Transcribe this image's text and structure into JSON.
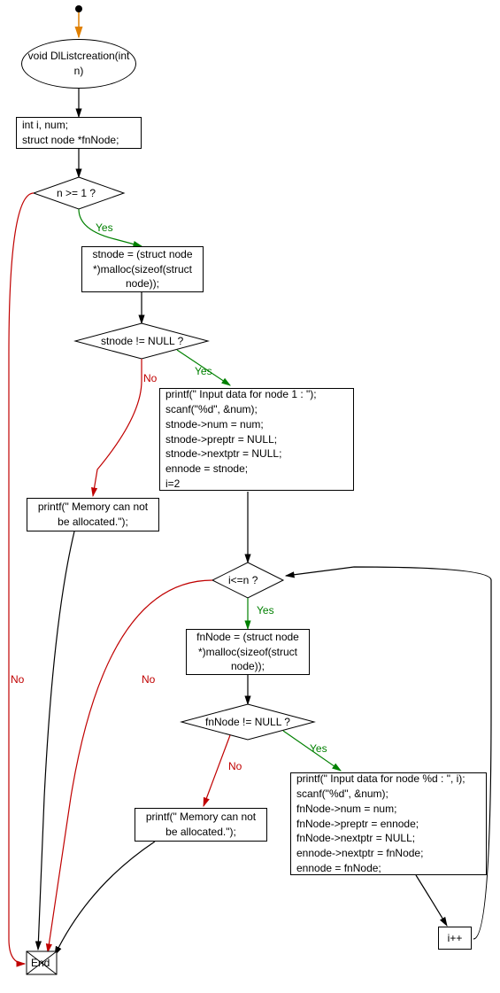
{
  "chart_data": {
    "type": "flowchart",
    "title": "void DlListcreation(int n)",
    "nodes": [
      {
        "id": "start",
        "type": "start",
        "label": ""
      },
      {
        "id": "func",
        "type": "terminator",
        "label": "void DlListcreation(int n)"
      },
      {
        "id": "decl",
        "type": "process",
        "label": "int i, num;\nstruct node *fnNode;"
      },
      {
        "id": "d1",
        "type": "decision",
        "label": "n >= 1 ?"
      },
      {
        "id": "p1",
        "type": "process",
        "label": "stnode = (struct node *)malloc(sizeof(struct node));"
      },
      {
        "id": "d2",
        "type": "decision",
        "label": "stnode != NULL ?"
      },
      {
        "id": "p2",
        "type": "process",
        "label": "printf(\" Input data for node 1 : \");\nscanf(\"%d\", &num);\nstnode->num = num;\nstnode->preptr = NULL;\nstnode->nextptr = NULL;\nennode = stnode;\ni=2"
      },
      {
        "id": "e1",
        "type": "process",
        "label": "printf(\" Memory can not be allocated.\");"
      },
      {
        "id": "d3",
        "type": "decision",
        "label": "i<=n ?"
      },
      {
        "id": "p3",
        "type": "process",
        "label": "fnNode = (struct node *)malloc(sizeof(struct node));"
      },
      {
        "id": "d4",
        "type": "decision",
        "label": "fnNode != NULL ?"
      },
      {
        "id": "p4",
        "type": "process",
        "label": "printf(\" Input data for node %d : \", i);\nscanf(\"%d\", &num);\nfnNode->num = num;\nfnNode->preptr = ennode;\nfnNode->nextptr = NULL;\nennode->nextptr = fnNode;\nennode = fnNode;"
      },
      {
        "id": "e2",
        "type": "process",
        "label": "printf(\" Memory can not be allocated.\");"
      },
      {
        "id": "inc",
        "type": "process",
        "label": "i++"
      },
      {
        "id": "end",
        "type": "end",
        "label": "End"
      }
    ],
    "edges": [
      {
        "from": "start",
        "to": "func"
      },
      {
        "from": "func",
        "to": "decl"
      },
      {
        "from": "decl",
        "to": "d1"
      },
      {
        "from": "d1",
        "to": "p1",
        "label": "Yes"
      },
      {
        "from": "d1",
        "to": "end",
        "label": "No"
      },
      {
        "from": "p1",
        "to": "d2"
      },
      {
        "from": "d2",
        "to": "p2",
        "label": "Yes"
      },
      {
        "from": "d2",
        "to": "e1",
        "label": "No"
      },
      {
        "from": "e1",
        "to": "end"
      },
      {
        "from": "p2",
        "to": "d3"
      },
      {
        "from": "d3",
        "to": "p3",
        "label": "Yes"
      },
      {
        "from": "d3",
        "to": "end",
        "label": "No"
      },
      {
        "from": "p3",
        "to": "d4"
      },
      {
        "from": "d4",
        "to": "p4",
        "label": "Yes"
      },
      {
        "from": "d4",
        "to": "e2",
        "label": "No"
      },
      {
        "from": "e2",
        "to": "end"
      },
      {
        "from": "p4",
        "to": "inc"
      },
      {
        "from": "inc",
        "to": "d3"
      }
    ]
  },
  "labels": {
    "func": "void DlListcreation(int\nn)",
    "decl": "int i, num;\nstruct node *fnNode;",
    "d1": "n >= 1 ?",
    "p1": "stnode = (struct node\n*)malloc(sizeof(struct\nnode));",
    "d2": "stnode != NULL ?",
    "p2": "printf(\" Input data for node 1 : \");\nscanf(\"%d\", &num);\nstnode->num = num;\nstnode->preptr = NULL;\nstnode->nextptr = NULL;\nennode = stnode;\ni=2",
    "e1": "printf(\" Memory can not\nbe allocated.\");",
    "d3": "i<=n ?",
    "p3": "fnNode = (struct node\n*)malloc(sizeof(struct\nnode));",
    "d4": "fnNode != NULL ?",
    "p4": "printf(\" Input data for node %d : \", i);\nscanf(\"%d\", &num);\nfnNode->num = num;\nfnNode->preptr = ennode;\nfnNode->nextptr = NULL;\nennode->nextptr = fnNode;\nennode = fnNode;",
    "e2": "printf(\" Memory can not\nbe allocated.\");",
    "inc": "i++",
    "end": "End",
    "yes": "Yes",
    "no": "No"
  }
}
